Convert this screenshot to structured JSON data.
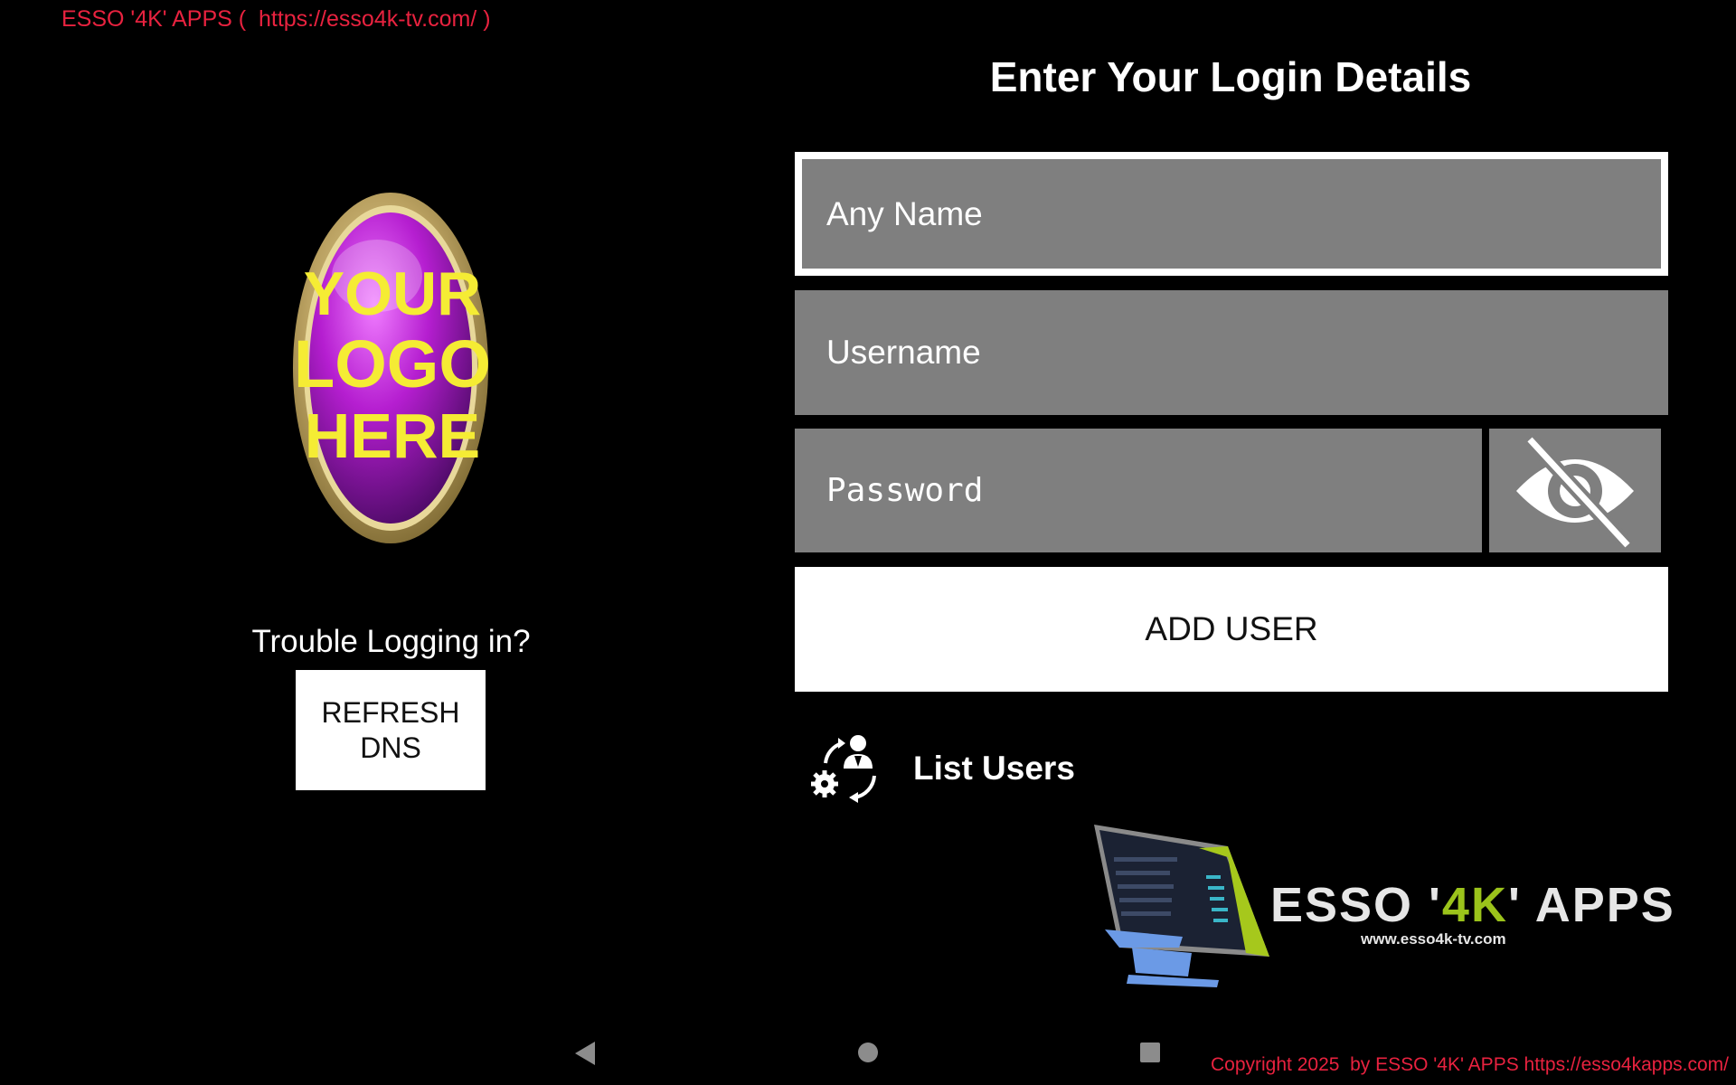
{
  "top_banner": "ESSO '4K' APPS (  https://esso4k-tv.com/ )",
  "logo": {
    "line1": "YOUR",
    "line2": "LOGO",
    "line3": "HERE"
  },
  "trouble_text": "Trouble Logging in?",
  "refresh_button": "REFRESH DNS",
  "login": {
    "title": "Enter Your Login Details",
    "any_name_placeholder": "Any Name",
    "username_placeholder": "Username",
    "password_placeholder": "Password",
    "add_user_button": "ADD USER",
    "list_users": "List Users"
  },
  "brand": {
    "name_pre": "ESSO '",
    "name_accent": "4K",
    "name_post": "' APPS",
    "url": "www.esso4k-tv.com",
    "accent_color": "#9bc31b"
  },
  "navbar": {
    "back": "back-icon",
    "home": "home-icon",
    "recents": "recents-icon"
  },
  "copyright": "Copyright 2025  by ESSO '4K' APPS https://esso4kapps.com/",
  "colors": {
    "background": "#000000",
    "field": "#7f7f7f",
    "banner_red": "#e8223f"
  }
}
